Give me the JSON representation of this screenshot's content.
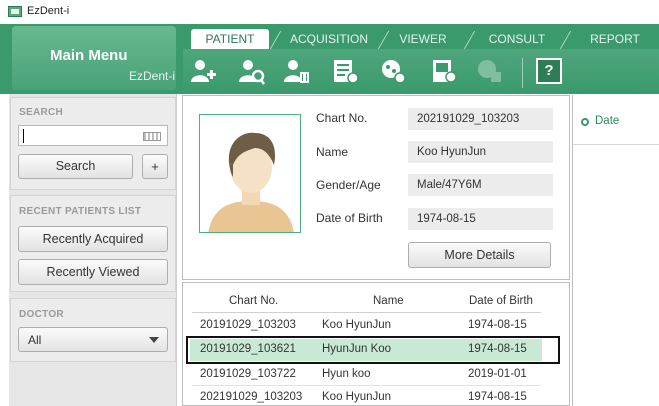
{
  "window": {
    "title": "EzDent-i"
  },
  "main_menu": {
    "title": "Main Menu",
    "subtitle": "EzDent-i"
  },
  "tabs": [
    {
      "label": "PATIENT",
      "active": true
    },
    {
      "label": "ACQUISITION",
      "active": false
    },
    {
      "label": "VIEWER",
      "active": false
    },
    {
      "label": "CONSULT",
      "active": false
    },
    {
      "label": "REPORT",
      "active": false
    }
  ],
  "toolbar": {
    "icons": [
      "add-patient-icon",
      "search-patient-icon",
      "delete-patient-icon",
      "patient-record-icon",
      "patient-photo-icon",
      "patient-image-icon",
      "disabled-tool-icon",
      "help-icon"
    ],
    "help_glyph": "?"
  },
  "search": {
    "section_title": "SEARCH",
    "input_value": "",
    "button_label": "Search",
    "plus_label": "+"
  },
  "recent": {
    "section_title": "RECENT PATIENTS LIST",
    "recently_acquired": "Recently Acquired",
    "recently_viewed": "Recently Viewed"
  },
  "doctor": {
    "section_title": "DOCTOR",
    "selected": "All"
  },
  "patient": {
    "chart_no_label": "Chart No.",
    "chart_no": "202191029_103203",
    "name_label": "Name",
    "name": "Koo HyunJun",
    "gender_age_label": "Gender/Age",
    "gender_age": "Male/47Y6M",
    "dob_label": "Date of Birth",
    "dob": "1974-08-15",
    "more_details": "More Details"
  },
  "patient_list": {
    "columns": [
      "Chart No.",
      "Name",
      "Date of Birth"
    ],
    "rows": [
      {
        "chart_no": "20191029_103203",
        "name": "Koo HyunJun",
        "dob": "1974-08-15",
        "selected": false
      },
      {
        "chart_no": "20191029_103621",
        "name": "HyunJun Koo",
        "dob": "1974-08-15",
        "selected": true
      },
      {
        "chart_no": "20191029_103722",
        "name": "Hyun koo",
        "dob": "2019-01-01",
        "selected": false
      },
      {
        "chart_no": "202191029_103203",
        "name": "Koo HyunJun",
        "dob": "1974-08-15",
        "selected": false
      }
    ]
  },
  "right_panel": {
    "radio_label": "Date"
  },
  "colors": {
    "brand_green": "#3a9a6b",
    "selected_row": "#c8ead4",
    "panel_bg": "#ececec"
  }
}
